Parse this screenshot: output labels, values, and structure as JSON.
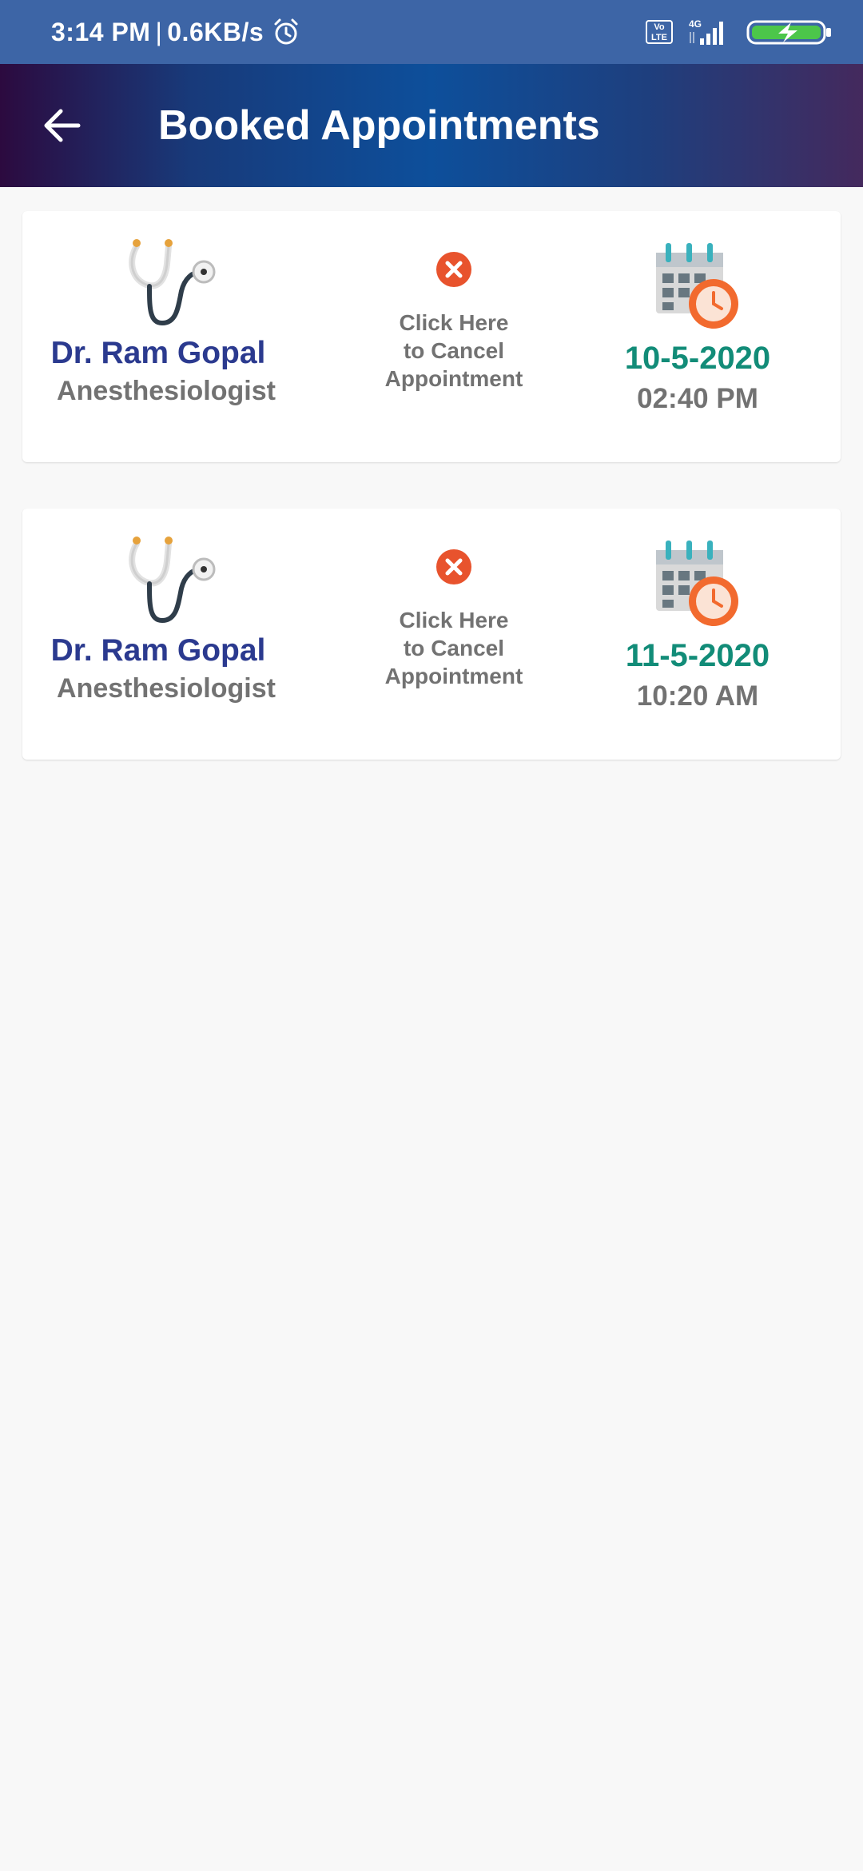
{
  "status_bar": {
    "time": "3:14 PM",
    "separator": "|",
    "speed": "0.6KB/s",
    "volte_line1": "Vo",
    "volte_line2": "LTE",
    "network": "4G",
    "icons": [
      "alarm-icon",
      "volte-icon",
      "signal-icon",
      "battery-charging-icon"
    ]
  },
  "app_bar": {
    "title": "Booked Appointments",
    "back_icon": "arrow-left-icon",
    "gradient": [
      "#2c0a3f",
      "#0d4f9b",
      "#44295d"
    ]
  },
  "appointments": [
    {
      "doctor": "Dr. Ram Gopal",
      "specialty": "Anesthesiologist",
      "cancel_line1": "Click Here",
      "cancel_line2": "to Cancel",
      "cancel_line3": "Appointment",
      "date": "10-5-2020",
      "time": "02:40 PM"
    },
    {
      "doctor": "Dr. Ram Gopal",
      "specialty": "Anesthesiologist",
      "cancel_line1": "Click Here",
      "cancel_line2": "to Cancel",
      "cancel_line3": "Appointment",
      "date": "11-5-2020",
      "time": "10:20 AM"
    }
  ],
  "colors": {
    "status_bar": "#3d65a6",
    "doctor_name": "#2b3a8f",
    "date": "#128c78",
    "secondary_text": "#727272",
    "cancel_icon": "#e8532d",
    "background": "#f8f8f8"
  }
}
